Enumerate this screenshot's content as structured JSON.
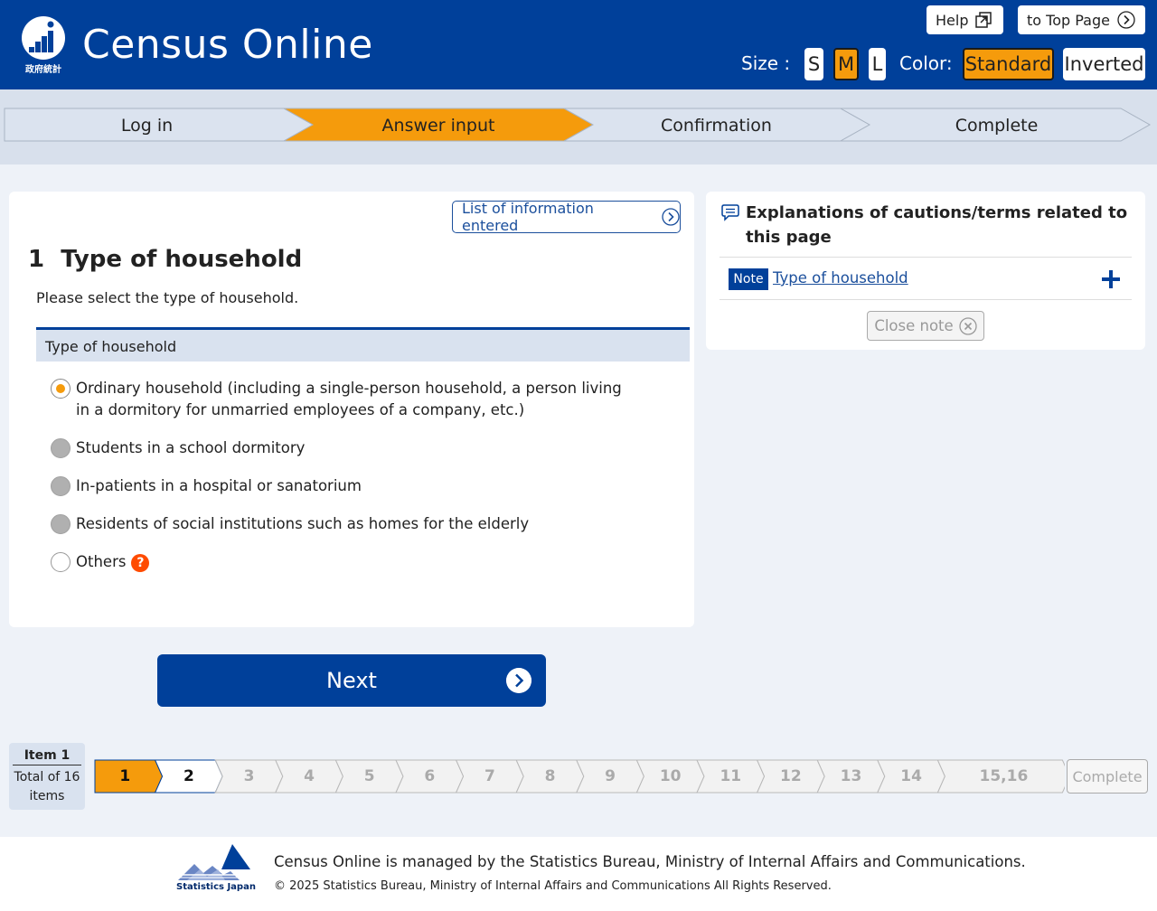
{
  "header": {
    "title": "Census Online",
    "logo_sub": "政府統計",
    "help_label": "Help",
    "top_page_label": "to Top Page",
    "size_label": "Size :",
    "size_options": [
      "S",
      "M",
      "L"
    ],
    "size_selected": "M",
    "color_label": "Color:",
    "color_options": [
      "Standard",
      "Inverted"
    ],
    "color_selected": "Standard"
  },
  "progress": {
    "steps": [
      "Log in",
      "Answer input",
      "Confirmation",
      "Complete"
    ],
    "active": "Answer input",
    "colors": {
      "active": "#f59b0c",
      "inactive": "#dbe3ef"
    }
  },
  "question": {
    "list_button": "List of information entered",
    "title": "1  Type of household",
    "instruction": "Please select the type of household.",
    "section_header": "Type of household",
    "options": [
      {
        "label": "Ordinary household (including a single-person household, a person living in a dormitory for unmarried employees of a company, etc.)",
        "state": "selected"
      },
      {
        "label": "Students in a school dormitory",
        "state": "disabled"
      },
      {
        "label": "In-patients in a hospital or sanatorium",
        "state": "disabled"
      },
      {
        "label": "Residents of social institutions such as homes for the elderly",
        "state": "disabled"
      },
      {
        "label": "Others",
        "state": "unselected",
        "help": "?"
      }
    ]
  },
  "next_label": "Next",
  "side_panel": {
    "title": "Explanations of cautions/terms related to this page",
    "note_tag": "Note",
    "note_link": "Type of household",
    "close_label": "Close note"
  },
  "item_nav": {
    "current": "Item 1",
    "total": "Total of 16 items",
    "items": [
      "1",
      "2",
      "3",
      "4",
      "5",
      "6",
      "7",
      "8",
      "9",
      "10",
      "11",
      "12",
      "13",
      "14",
      "15,16"
    ],
    "current_index": 0,
    "complete_label": "Complete"
  },
  "footer": {
    "logo_text": "Statistics Japan",
    "managed": "Census Online is managed by the Statistics Bureau, Ministry of Internal Affairs and Communications.",
    "copyright": "© 2025 Statistics Bureau, Ministry of Internal Affairs and Communications All Rights Reserved."
  },
  "colors": {
    "brand": "#00409a",
    "accent": "#f59b0c",
    "help": "#ff4b00"
  }
}
